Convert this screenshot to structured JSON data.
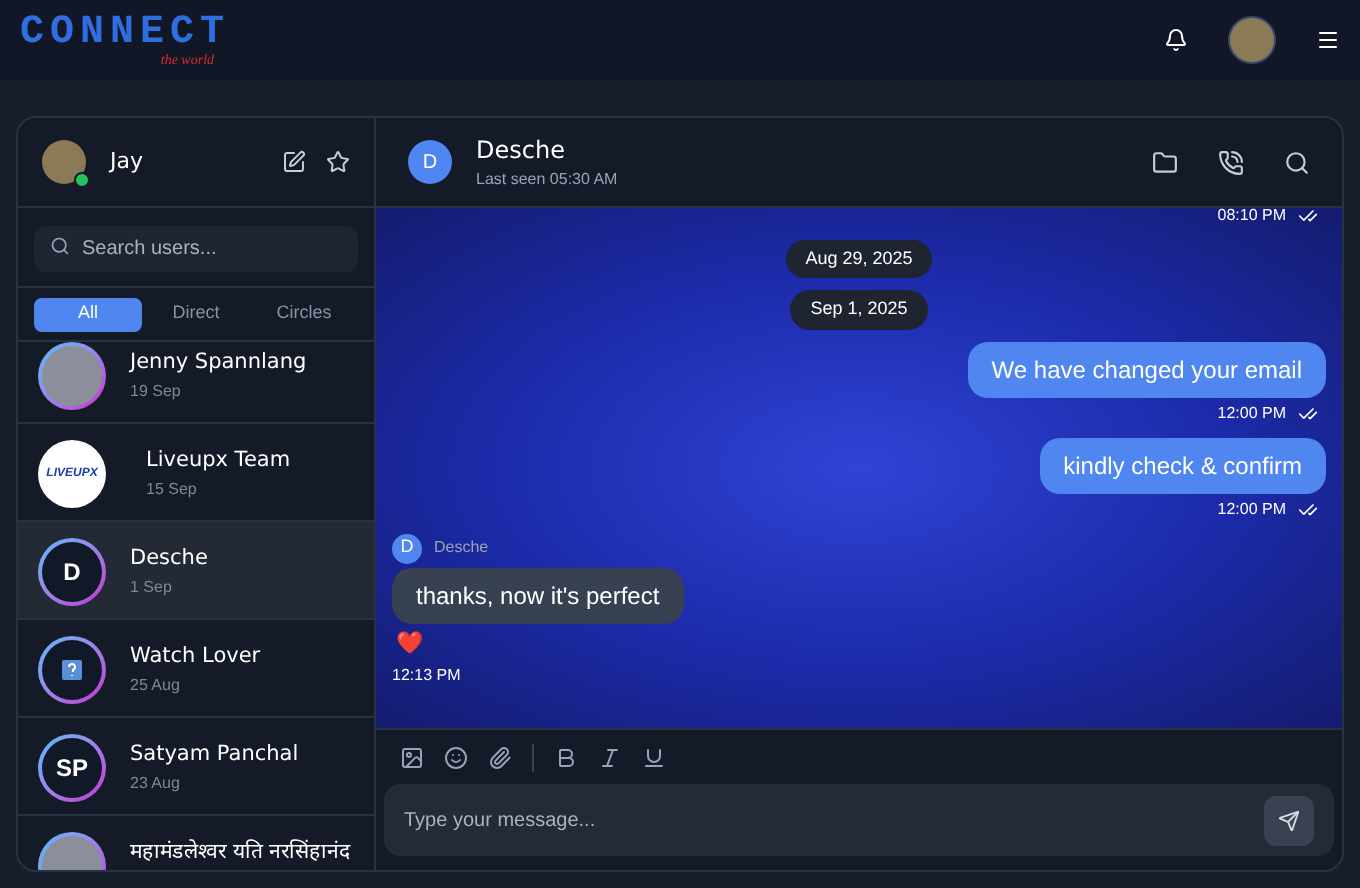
{
  "app": {
    "logo": "CONNECT",
    "tagline": "the world"
  },
  "me": {
    "name": "Jay",
    "online": true
  },
  "search": {
    "placeholder": "Search users..."
  },
  "tabs": [
    {
      "label": "All",
      "selected": true
    },
    {
      "label": "Direct",
      "selected": false
    },
    {
      "label": "Circles",
      "selected": false
    }
  ],
  "contacts": [
    {
      "name": "Jenny Spannlang",
      "date": "19 Sep",
      "avatar": {
        "kind": "photo"
      },
      "selected": false
    },
    {
      "name": "Liveupx Team",
      "date": "15 Sep",
      "avatar": {
        "kind": "logo",
        "text": "LIVEUPX"
      },
      "selected": false
    },
    {
      "name": "Desche",
      "date": "1 Sep",
      "avatar": {
        "kind": "initials",
        "text": "D"
      },
      "selected": true
    },
    {
      "name": "Watch Lover",
      "date": "25 Aug",
      "avatar": {
        "kind": "icon"
      },
      "selected": false
    },
    {
      "name": "Satyam Panchal",
      "date": "23 Aug",
      "avatar": {
        "kind": "initials",
        "text": "SP"
      },
      "selected": false
    },
    {
      "name": "महामंडलेश्वर यति नरसिंहानंद",
      "avatar": {
        "kind": "photo"
      },
      "selected": false
    }
  ],
  "chat": {
    "name": "Desche",
    "avatar": "D",
    "status": "Last seen 05:30 AM"
  },
  "messages": [
    {
      "kind": "out",
      "time": "08:10 PM",
      "read": true
    },
    {
      "kind": "date",
      "text": "Aug 29, 2025"
    },
    {
      "kind": "date",
      "text": "Sep 1, 2025"
    },
    {
      "kind": "out",
      "text": "We have changed your email",
      "time": "12:00 PM",
      "read": true
    },
    {
      "kind": "out",
      "text": "kindly check & confirm",
      "time": "12:00 PM",
      "read": true
    },
    {
      "kind": "in",
      "sender": "Desche",
      "avatar": "D",
      "text": "thanks, now it's perfect",
      "reaction": "❤️",
      "time": "12:13 PM"
    }
  ],
  "composer": {
    "placeholder": "Type your message..."
  }
}
